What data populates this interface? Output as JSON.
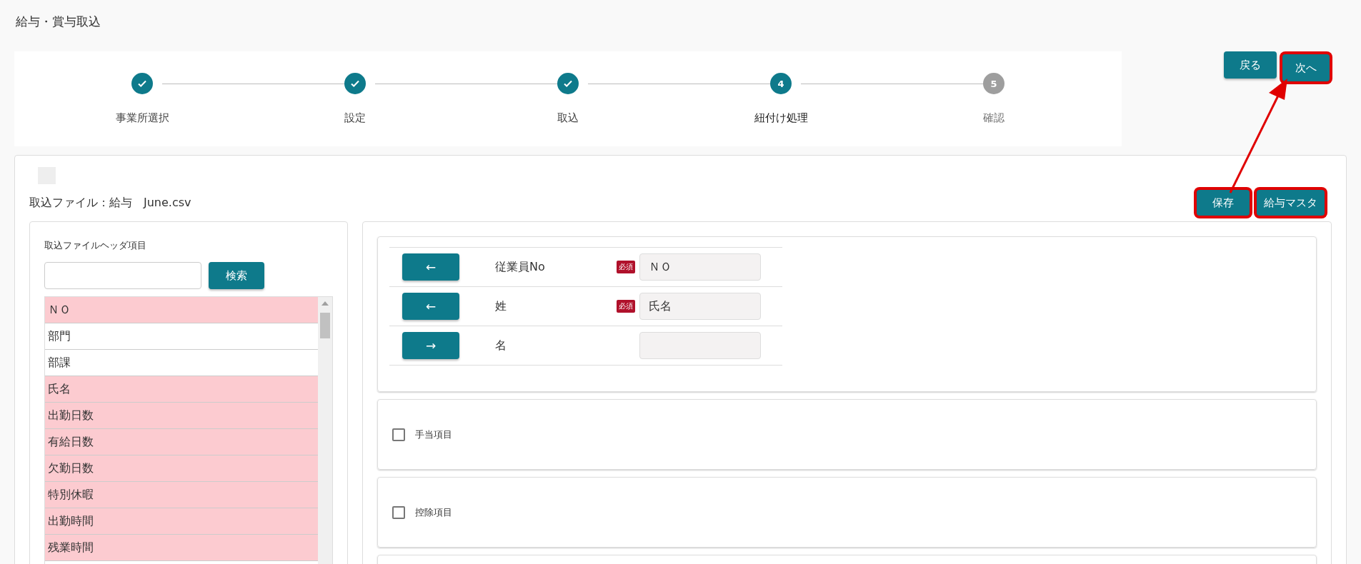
{
  "page_title": "給与・賞与取込",
  "steps": [
    {
      "label": "事業所選択",
      "completed": true,
      "current": false
    },
    {
      "label": "設定",
      "completed": true,
      "current": false
    },
    {
      "label": "取込",
      "completed": true,
      "current": false
    },
    {
      "label": "紐付け処理",
      "completed": false,
      "current": true,
      "number": "4"
    },
    {
      "label": "確認",
      "completed": false,
      "current": false,
      "number": "5"
    }
  ],
  "nav_buttons": [
    {
      "label": "戻る",
      "highlighted": false
    },
    {
      "label": "次へ",
      "highlighted": true
    }
  ],
  "import_file_label": "取込ファイル：給与　June.csv",
  "action_buttons": [
    {
      "label": "保存",
      "highlighted": true
    },
    {
      "label": "給与マスタ",
      "highlighted": true
    }
  ],
  "header_panel": {
    "title": "取込ファイルヘッダ項目",
    "search_button": "検索",
    "items": [
      {
        "label": "ＮＯ",
        "mapped": true
      },
      {
        "label": "部門",
        "mapped": false
      },
      {
        "label": "部課",
        "mapped": false
      },
      {
        "label": "氏名",
        "mapped": true
      },
      {
        "label": "出勤日数",
        "mapped": true
      },
      {
        "label": "有給日数",
        "mapped": true
      },
      {
        "label": "欠勤日数",
        "mapped": true
      },
      {
        "label": "特別休暇",
        "mapped": true
      },
      {
        "label": "出勤時間",
        "mapped": true
      },
      {
        "label": "残業時間",
        "mapped": true
      }
    ]
  },
  "mapping_rows": [
    {
      "arrow": "←",
      "label": "従業員No",
      "required": "必須",
      "value": "ＮＯ"
    },
    {
      "arrow": "←",
      "label": "姓",
      "required": "必須",
      "value": "氏名"
    },
    {
      "arrow": "→",
      "label": "名"
    }
  ],
  "sections": [
    {
      "label": "手当項目",
      "checked": false
    },
    {
      "label": "控除項目",
      "checked": false
    }
  ]
}
